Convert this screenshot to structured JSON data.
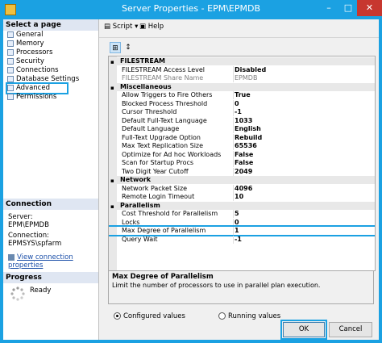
{
  "window": {
    "title": "Server Properties - EPM\\EPMDB",
    "minimize": "–",
    "maximize": "□",
    "close": "✕"
  },
  "left": {
    "select_page_header": "Select a page",
    "pages": [
      "General",
      "Memory",
      "Processors",
      "Security",
      "Connections",
      "Database Settings",
      "Advanced",
      "Permissions"
    ],
    "selected_page": "Advanced",
    "connection_header": "Connection",
    "server_label": "Server:",
    "server_value": "EPM\\EPMDB",
    "connection_label": "Connection:",
    "connection_value": "EPMSYS\\spfarm",
    "view_link": "View connection properties",
    "progress_header": "Progress",
    "progress_status": "Ready"
  },
  "toolbar": {
    "script": "Script",
    "help": "Help"
  },
  "grid": {
    "rows": [
      {
        "type": "cat",
        "name": "FILESTREAM"
      },
      {
        "type": "prop",
        "name": "FILESTREAM Access Level",
        "value": "Disabled"
      },
      {
        "type": "gray",
        "name": "FILESTREAM Share Name",
        "value": "EPMDB"
      },
      {
        "type": "cat",
        "name": "Miscellaneous"
      },
      {
        "type": "prop",
        "name": "Allow Triggers to Fire Others",
        "value": "True"
      },
      {
        "type": "prop",
        "name": "Blocked Process Threshold",
        "value": "0"
      },
      {
        "type": "prop",
        "name": "Cursor Threshold",
        "value": "-1"
      },
      {
        "type": "prop",
        "name": "Default Full-Text Language",
        "value": "1033"
      },
      {
        "type": "prop",
        "name": "Default Language",
        "value": "English"
      },
      {
        "type": "prop",
        "name": "Full-Text Upgrade Option",
        "value": "Rebuild"
      },
      {
        "type": "prop",
        "name": "Max Text Replication Size",
        "value": "65536"
      },
      {
        "type": "prop",
        "name": "Optimize for Ad hoc Workloads",
        "value": "False"
      },
      {
        "type": "prop",
        "name": "Scan for Startup Procs",
        "value": "False"
      },
      {
        "type": "prop",
        "name": "Two Digit Year Cutoff",
        "value": "2049"
      },
      {
        "type": "cat",
        "name": "Network"
      },
      {
        "type": "prop",
        "name": "Network Packet Size",
        "value": "4096"
      },
      {
        "type": "prop",
        "name": "Remote Login Timeout",
        "value": "10"
      },
      {
        "type": "cat",
        "name": "Parallelism"
      },
      {
        "type": "prop",
        "name": "Cost Threshold for Parallelism",
        "value": "5"
      },
      {
        "type": "prop",
        "name": "Locks",
        "value": "0"
      },
      {
        "type": "sel",
        "name": "Max Degree of Parallelism",
        "value": "1"
      },
      {
        "type": "prop",
        "name": "Query Wait",
        "value": "-1"
      }
    ]
  },
  "description": {
    "title": "Max Degree of Parallelism",
    "text": "Limit the number of processors to use in parallel plan execution."
  },
  "radios": {
    "configured": "Configured values",
    "running": "Running values",
    "selected": "configured"
  },
  "buttons": {
    "ok": "OK",
    "cancel": "Cancel"
  },
  "colors": {
    "accent": "#1ba1e2",
    "close": "#c7372f"
  }
}
